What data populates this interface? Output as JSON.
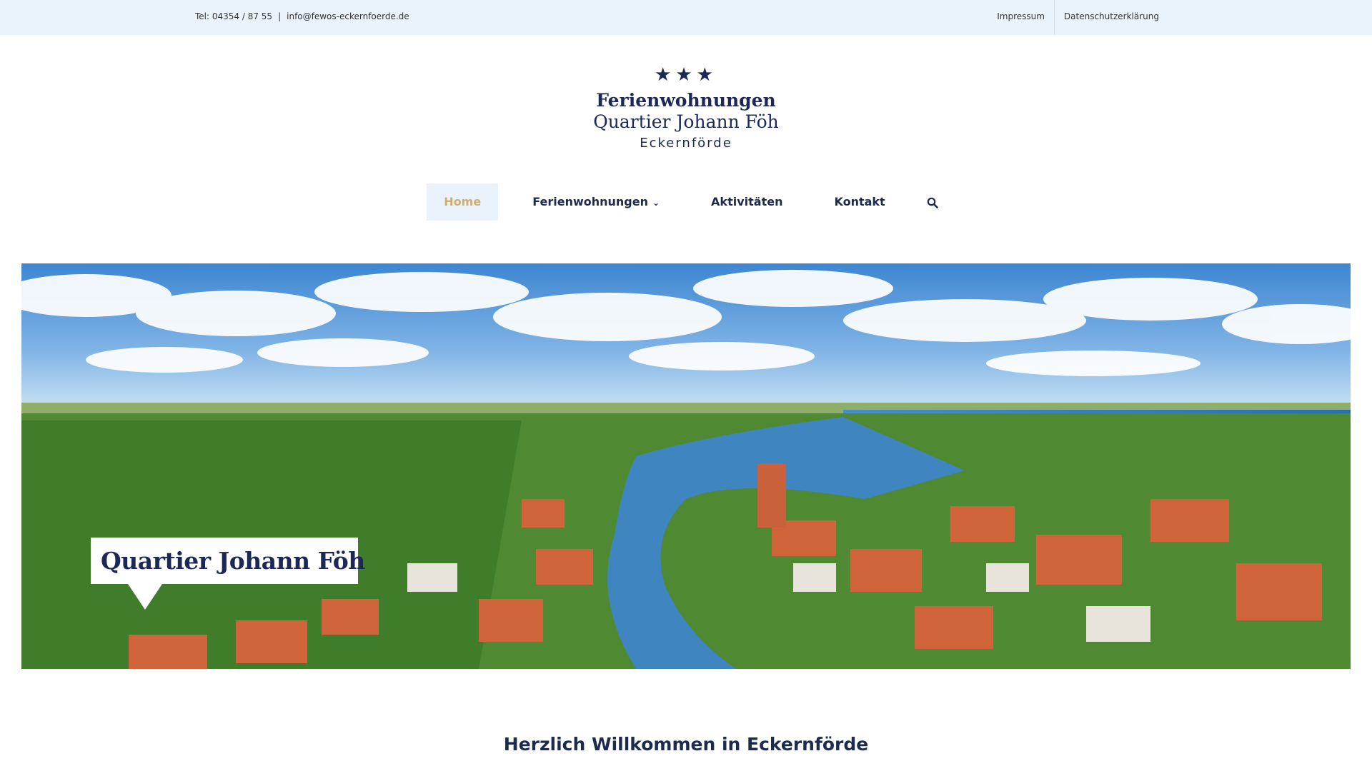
{
  "topbar": {
    "phone": "Tel: 04354 / 87 55",
    "separator": "|",
    "email": "info@fewos-eckernfoerde.de",
    "links": [
      "Impressum",
      "Datenschutzerklärung"
    ]
  },
  "logo": {
    "stars": "★★★",
    "line1": "Ferienwohnungen",
    "line2": "Quartier Johann Föh",
    "line3": "Eckernförde"
  },
  "nav": {
    "items": [
      {
        "label": "Home",
        "active": true
      },
      {
        "label": "Ferienwohnungen",
        "has_dropdown": true
      },
      {
        "label": "Aktivitäten"
      },
      {
        "label": "Kontakt"
      }
    ],
    "search_icon": "search-icon",
    "dropdown_icon": "chevron-down-icon"
  },
  "hero": {
    "callout": "Quartier Johann Föh"
  },
  "welcome": {
    "heading": "Herzlich Willkommen in Eckernförde"
  },
  "colors": {
    "topbar_bg": "#eaf2fb",
    "brand_navy": "#1c2857",
    "active_gold": "#d1ad6e",
    "sea": "#2f7ab8",
    "roofs": "#d0643b"
  }
}
